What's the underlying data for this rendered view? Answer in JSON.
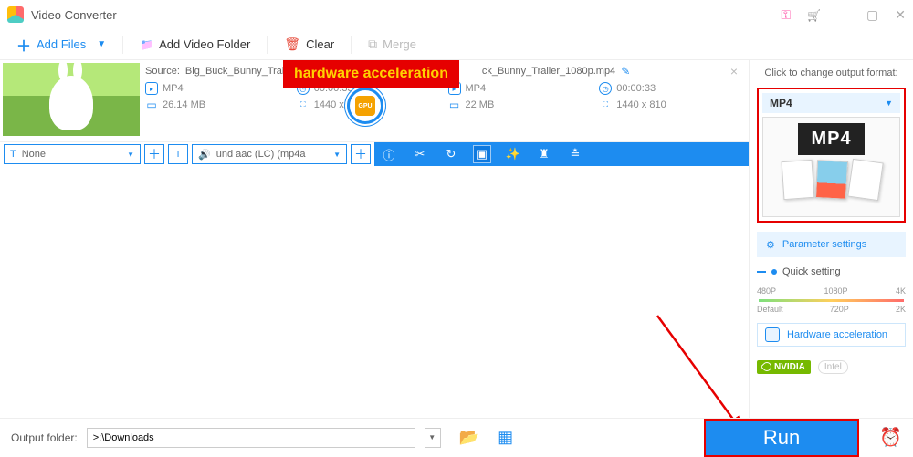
{
  "app": {
    "title": "Video Converter"
  },
  "toolbar": {
    "add_files": "Add Files",
    "add_folder": "Add Video Folder",
    "clear": "Clear",
    "merge": "Merge"
  },
  "file": {
    "source_label": "Source:",
    "source_left": "Big_Buck_Bunny_Trailer_1",
    "source_right": "ck_Bunny_Trailer_1080p.mp4",
    "in": {
      "format": "MP4",
      "duration": "00:00:33",
      "size": "26.14 MB",
      "resolution": "1440 x 1080"
    },
    "out": {
      "format": "MP4",
      "duration": "00:00:33",
      "size": "22 MB",
      "resolution": "1440 x 810"
    }
  },
  "actions": {
    "subtitle": "None",
    "audio_track": "und aac (LC) (mp4a"
  },
  "callout": {
    "label": "hardware acceleration",
    "gpu_chip": "GPU"
  },
  "side": {
    "hint": "Click to change output format:",
    "format": "MP4",
    "film_label": "MP4",
    "parameter_settings": "Parameter settings",
    "quick_setting": "Quick setting",
    "ticks_top": [
      "480P",
      "1080P",
      "4K"
    ],
    "ticks_bottom": [
      "Default",
      "720P",
      "2K"
    ],
    "hw_accel": "Hardware acceleration",
    "vendors": {
      "nvidia": "NVIDIA",
      "intel": "Intel"
    }
  },
  "footer": {
    "output_label": "Output folder:",
    "output_path": ">:\\Downloads",
    "run": "Run"
  }
}
